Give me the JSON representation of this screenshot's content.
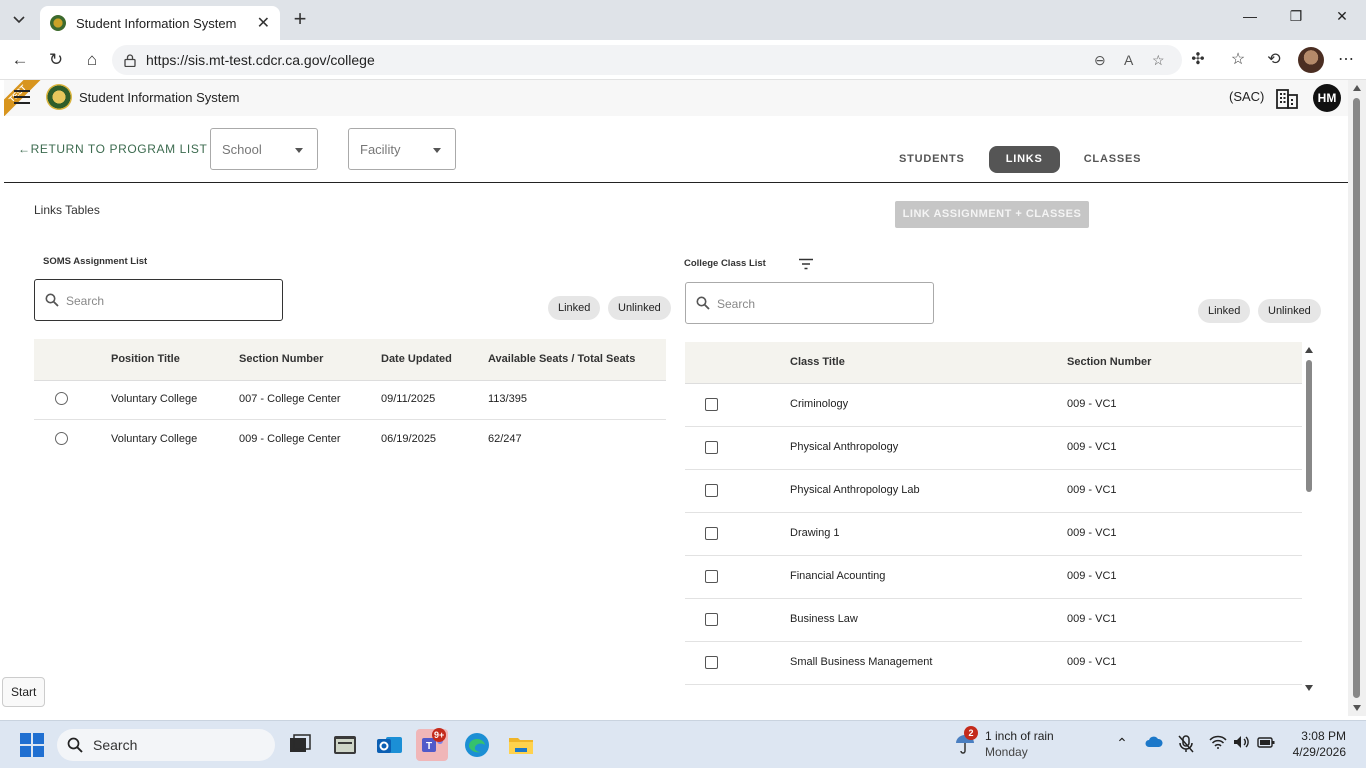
{
  "browser": {
    "tab_title": "Student Information System",
    "url": "https://sis.mt-test.cdcr.ca.gov/college"
  },
  "app": {
    "title": "Student Information System",
    "test_ribbon": "TEST",
    "region": "(SAC)",
    "avatar_initials": "HM"
  },
  "toolbar": {
    "return_label": "RETURN TO PROGRAM LIST",
    "school_placeholder": "School",
    "facility_placeholder": "Facility",
    "tabs": [
      "STUDENTS",
      "LINKS",
      "CLASSES"
    ],
    "active_tab": "LINKS"
  },
  "main": {
    "section_title": "Links Tables",
    "link_button": "LINK ASSIGNMENT + CLASSES"
  },
  "soms": {
    "label": "SOMS Assignment List",
    "search_placeholder": "Search",
    "chips": [
      "Linked",
      "Unlinked"
    ],
    "columns": [
      "Position Title",
      "Section Number",
      "Date Updated",
      "Available Seats / Total Seats"
    ],
    "rows": [
      [
        "Voluntary College",
        "007 - College Center",
        "09/11/2025",
        "113/395"
      ],
      [
        "Voluntary College",
        "009 - College Center",
        "06/19/2025",
        "62/247"
      ]
    ]
  },
  "college": {
    "label": "College Class List",
    "search_placeholder": "Search",
    "chips": [
      "Linked",
      "Unlinked"
    ],
    "columns": [
      "Class Title",
      "Section Number"
    ],
    "rows": [
      [
        "Criminology",
        "009 - VC1"
      ],
      [
        "Physical Anthropology",
        "009 - VC1"
      ],
      [
        "Physical Anthropology Lab",
        "009 - VC1"
      ],
      [
        "Drawing 1",
        "009 - VC1"
      ],
      [
        "Financial Acounting",
        "009 - VC1"
      ],
      [
        "Business Law",
        "009 - VC1"
      ],
      [
        "Small Business Management",
        "009 - VC1"
      ]
    ]
  },
  "tooltip": {
    "start": "Start"
  },
  "taskbar": {
    "search": "Search",
    "outlook_badge": "",
    "teams_badge": "9+",
    "weather_badge": "2",
    "weather_line1": "1 inch of rain",
    "weather_line2": "Monday",
    "time": "3:08 PM",
    "date": "4/29/2026"
  },
  "colors": {
    "accent_green": "#3c6b4f",
    "active_tab": "#555555",
    "disabled_button": "#c6c6c6",
    "table_header_bg": "#f4f3ee"
  }
}
